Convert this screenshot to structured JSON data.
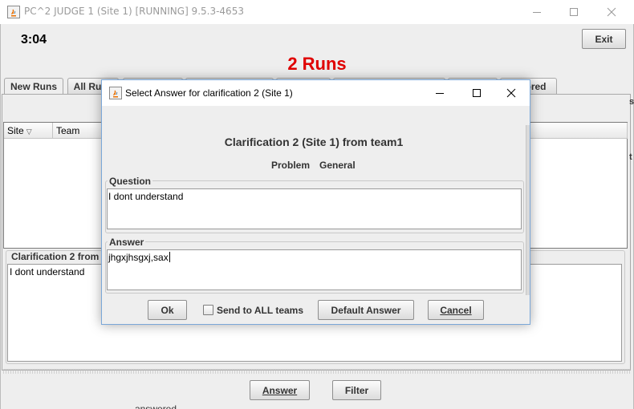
{
  "window": {
    "title": "PC^2 JUDGE 1 (Site 1) [RUNNING] 9.5.3-4653",
    "clock": "3:04",
    "exit_label": "Exit",
    "runs_title": "2 Runs"
  },
  "tabs": [
    {
      "label": "New Runs",
      "active": true
    },
    {
      "label": "All Runs",
      "active": false
    },
    {
      "label": "",
      "active": false
    },
    {
      "label": "",
      "active": false
    },
    {
      "label": "",
      "active": false
    },
    {
      "label": "",
      "active": false
    },
    {
      "label": "Ignored",
      "active": false
    }
  ],
  "table": {
    "columns": [
      "Site",
      "Team"
    ]
  },
  "clarification": {
    "legend": "Clarification 2  from",
    "text": "I dont understand"
  },
  "bottom": {
    "answer_label": "Answer",
    "filter_label": "Filter",
    "status_peek": "answered"
  },
  "side_glyphs": [
    "s",
    "t"
  ],
  "dialog": {
    "title": "Select Answer for clarification 2 (Site 1)",
    "heading": "Clarification 2 (Site 1) from team1",
    "problem_label": "Problem",
    "problem_value": "General",
    "question_legend": "Question",
    "question_text": "I dont understand",
    "answer_legend": "Answer",
    "answer_text": "jhgxjhsgxj,sax",
    "ok_label": "Ok",
    "send_all_label": "Send to ALL teams",
    "send_all_checked": false,
    "default_answer_label": "Default Answer",
    "cancel_label": "Cancel"
  },
  "colors": {
    "runs_title": "#e00000",
    "dialog_border": "#7aa7d8"
  }
}
